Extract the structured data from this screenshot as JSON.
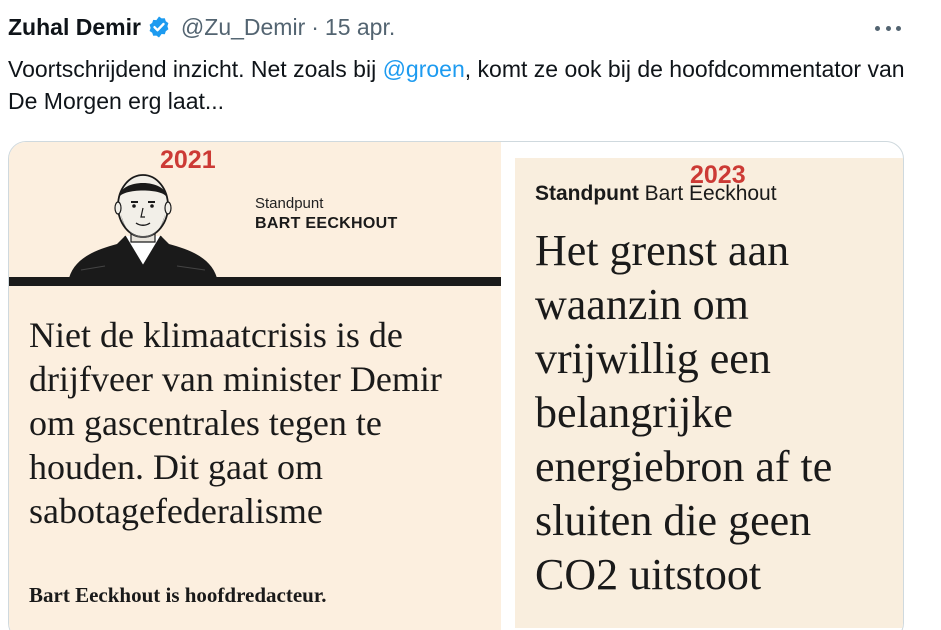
{
  "tweet": {
    "author_name": "Zuhal Demir",
    "handle": "@Zu_Demir",
    "separator": "·",
    "date": "15 apr.",
    "text_before": "Voortschrijdend inzicht. Net zoals bij ",
    "mention": "@groen",
    "text_after": ", komt ze ook bij de hoofdcommentator van De Morgen erg laat...",
    "accent_color": "#1d9bf0"
  },
  "media": {
    "left": {
      "year": "2021",
      "standpunt_label": "Standpunt",
      "author_upper": "BART EECKHOUT",
      "headline": "Niet de klimaatcrisis is de drijfveer van minister Demir om gascentrales tegen te houden. Dit gaat om sabotagefederalisme",
      "byline": "Bart Eeckhout is hoofdredacteur."
    },
    "right": {
      "year": "2023",
      "standpunt_label": "Standpunt",
      "author": "Bart Eeckhout",
      "headline": "Het grenst aan waanzin om vrijwillig een belangrijke energiebron af te sluiten die geen CO2 uitstoot"
    },
    "year_color": "#cc3a35"
  }
}
